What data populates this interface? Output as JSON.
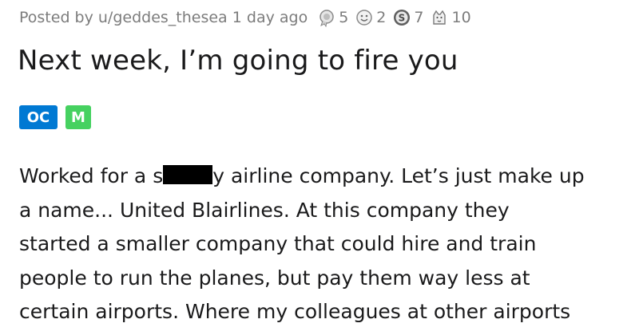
{
  "post": {
    "posted_by": "Posted by u/geddes_thesea",
    "age": "1 day ago",
    "awards": [
      {
        "icon": "silver-award-icon",
        "count": "5"
      },
      {
        "icon": "helpful-award-icon",
        "count": "2"
      },
      {
        "icon": "coin-award-icon",
        "count": "7"
      },
      {
        "icon": "wholesome-award-icon",
        "count": "10"
      }
    ],
    "title": "Next week, I’m going to fire you",
    "flairs": {
      "oc": "OC",
      "mod": "M"
    },
    "body": {
      "line1_before": "Worked for a s",
      "line1_after": "y airline company. Let’s just make up",
      "line2": "a name... United Blairlines. At this company they",
      "line3": "started a smaller company that could hire and train",
      "line4": "people to run the planes, but pay them way less at",
      "line5": "certain airports. Where my colleagues at other airports"
    }
  }
}
